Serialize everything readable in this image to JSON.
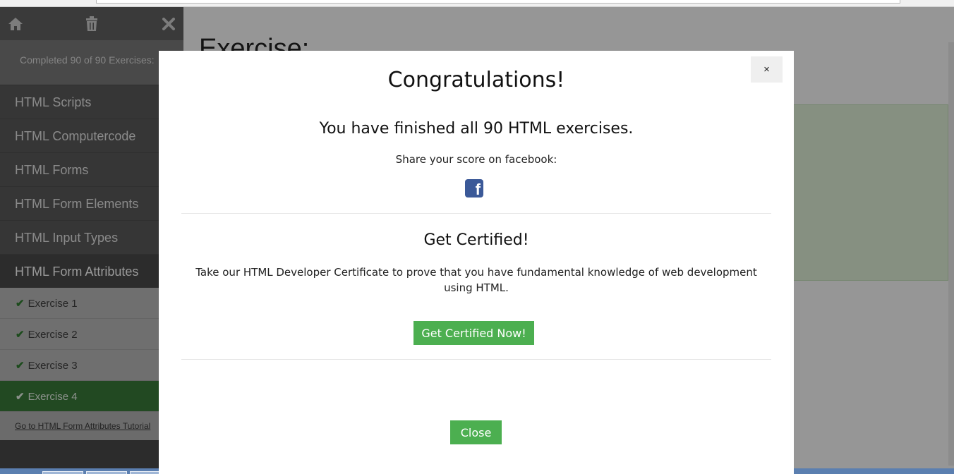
{
  "sidebar": {
    "progress": "Completed 90 of 90 Exercises:",
    "chapters": [
      {
        "label": "HTML Scripts"
      },
      {
        "label": "HTML Computercode"
      },
      {
        "label": "HTML Forms"
      },
      {
        "label": "HTML Form Elements"
      },
      {
        "label": "HTML Input Types"
      },
      {
        "label": "HTML Form Attributes"
      }
    ],
    "exercises": [
      {
        "label": "Exercise 1"
      },
      {
        "label": "Exercise 2"
      },
      {
        "label": "Exercise 3"
      },
      {
        "label": "Exercise 4"
      }
    ],
    "tutorial_link": "Go to HTML Form Attributes Tutorial",
    "icons": {
      "home": "home-icon",
      "trash": "trash-icon",
      "close": "close-icon"
    }
  },
  "main": {
    "heading": "Exercise:"
  },
  "modal": {
    "close_x": "×",
    "title": "Congratulations!",
    "finished": "You have finished all 90 HTML exercises.",
    "share": "Share your score on facebook:",
    "facebook_letter": "f",
    "cert_title": "Get Certified!",
    "cert_text": "Take our HTML Developer Certificate to prove that you have fundamental knowledge of web development using HTML.",
    "cert_button": "Get Certified Now!",
    "close_button": "Close"
  },
  "colors": {
    "accent_green": "#4caf50",
    "facebook_blue": "#3b5998",
    "sidebar_dark": "#5a5a5a"
  }
}
